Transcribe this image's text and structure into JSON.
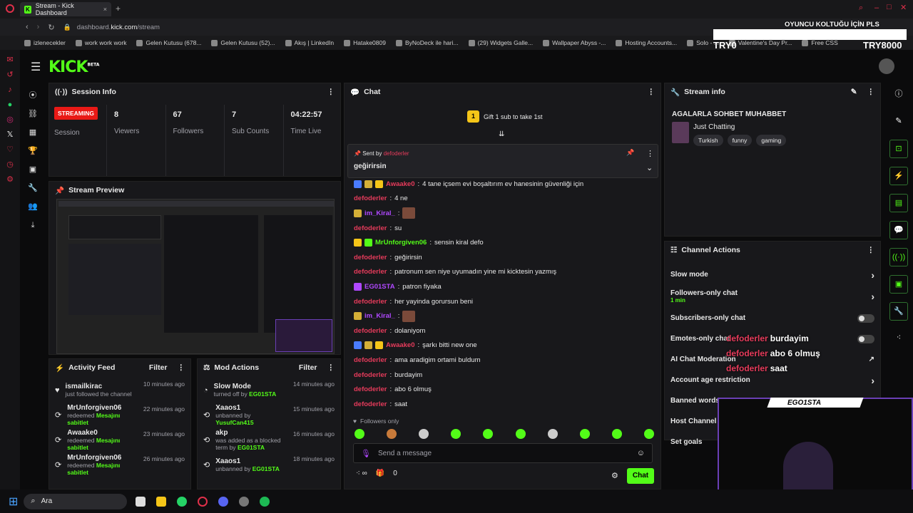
{
  "browser": {
    "tab_title": "Stream - Kick Dashboard",
    "url_prefix": "dashboard.",
    "url_domain": "kick.com",
    "url_path": "/stream",
    "bookmarks": [
      "izlenecekler",
      "work work work",
      "Gelen Kutusu (678...",
      "Gelen Kutusu (52)...",
      "Akış | LinkedIn",
      "Hatake0809",
      "ByNoDeck ile hari...",
      "(29) Widgets Galle...",
      "Wallpaper Abyss -...",
      "Hosting Accounts...",
      "Solo - ...",
      "Valentine's Day Pr...",
      "Free CSS"
    ]
  },
  "overlay_top": {
    "banner": "OYUNCU KOLTUĞU İÇİN PLS",
    "left": "TRY0",
    "right": "TRY8000"
  },
  "brand": {
    "logo": "KICK",
    "beta": "BETA"
  },
  "session": {
    "title": "Session Info",
    "status_badge": "STREAMING",
    "session_label": "Session",
    "stats": [
      {
        "value": "8",
        "label": "Viewers"
      },
      {
        "value": "67",
        "label": "Followers"
      },
      {
        "value": "7",
        "label": "Sub Counts"
      },
      {
        "value": "04:22:57",
        "label": "Time Live"
      }
    ]
  },
  "preview": {
    "title": "Stream Preview"
  },
  "activity": {
    "title": "Activity Feed",
    "filter": "Filter",
    "items": [
      {
        "user": "ismailkirac",
        "action": "just followed the channel",
        "extra": "",
        "time": "10 minutes ago"
      },
      {
        "user": "MrUnforgiven06",
        "action": "redeemed",
        "extra": "Mesajını sabitlet",
        "time": "22 minutes ago"
      },
      {
        "user": "Awaake0",
        "action": "redeemed",
        "extra": "Mesajını sabitlet",
        "time": "23 minutes ago"
      },
      {
        "user": "MrUnforgiven06",
        "action": "redeemed",
        "extra": "Mesajını sabitlet",
        "time": "26 minutes ago"
      }
    ]
  },
  "mod": {
    "title": "Mod Actions",
    "filter": "Filter",
    "items": [
      {
        "title": "Slow Mode",
        "action": "turned off by",
        "by": "EG01STA",
        "time": "14 minutes ago"
      },
      {
        "title": "Xaaos1",
        "action": "unbanned by",
        "by": "YusufCan415",
        "time": "15 minutes ago"
      },
      {
        "title": "akp",
        "action": "was added as a blocked term by",
        "by": "EG01STA",
        "time": "16 minutes ago"
      },
      {
        "title": "Xaaos1",
        "action": "unbanned by",
        "by": "EG01STA",
        "time": "18 minutes ago"
      }
    ]
  },
  "chat": {
    "title": "Chat",
    "gift_count": "1",
    "gift_text": "Gift 1 sub to take 1st",
    "pinned_prefix": "Sent by",
    "pinned_user": "defoderler",
    "pinned_msg": "geğirirsin",
    "messages": [
      {
        "user": "Awaake0",
        "color": "#e63b5b",
        "badges": [
          "#4a7cff",
          "#d4af37",
          "#f5c518"
        ],
        "text": "4 tane içsem evi boşaltırım ev hanesinin güvenliği için"
      },
      {
        "user": "defoderler",
        "color": "#e63b5b",
        "badges": [],
        "text": "4 ne"
      },
      {
        "user": "im_Kiral_",
        "color": "#b048ff",
        "badges": [
          "#d4af37"
        ],
        "text": ""
      },
      {
        "user": "defoderler",
        "color": "#e63b5b",
        "badges": [],
        "text": "su"
      },
      {
        "user": "MrUnforgiven06",
        "color": "#53fc18",
        "badges": [
          "#f5c518",
          "#53fc18"
        ],
        "text": "sensin kiral defo"
      },
      {
        "user": "defoderler",
        "color": "#e63b5b",
        "badges": [],
        "text": "geğirirsin"
      },
      {
        "user": "defoderler",
        "color": "#e63b5b",
        "badges": [],
        "text": "patronum sen niye uyumadın yine mi kicktesin yazmış"
      },
      {
        "user": "EG01STA",
        "color": "#b048ff",
        "badges": [
          "#b048ff"
        ],
        "text": "patron fiyaka"
      },
      {
        "user": "defoderler",
        "color": "#e63b5b",
        "badges": [],
        "text": "her yayinda gorursun beni"
      },
      {
        "user": "im_Kiral_",
        "color": "#b048ff",
        "badges": [
          "#d4af37"
        ],
        "text": ""
      },
      {
        "user": "defoderler",
        "color": "#e63b5b",
        "badges": [],
        "text": "dolaniyom"
      },
      {
        "user": "Awaake0",
        "color": "#e63b5b",
        "badges": [
          "#4a7cff",
          "#d4af37",
          "#f5c518"
        ],
        "text": "şarkı bitti new one"
      },
      {
        "user": "defoderler",
        "color": "#e63b5b",
        "badges": [],
        "text": "ama aradigim ortami buldum"
      },
      {
        "user": "defoderler",
        "color": "#e63b5b",
        "badges": [],
        "text": "burdayim"
      },
      {
        "user": "defoderler",
        "color": "#e63b5b",
        "badges": [],
        "text": "abo 6 olmuş"
      },
      {
        "user": "defoderler",
        "color": "#e63b5b",
        "badges": [],
        "text": "saat"
      }
    ],
    "followers_only": "Followers only",
    "input_placeholder": "Send a message",
    "points": "0",
    "send_label": "Chat"
  },
  "stream_info": {
    "title": "Stream info",
    "stream_title": "AGALARLA SOHBET MUHABBET",
    "category": "Just Chatting",
    "tags": [
      "Turkish",
      "funny",
      "gaming"
    ]
  },
  "channel_actions": {
    "title": "Channel Actions",
    "items": [
      {
        "label": "Slow mode",
        "sub": "",
        "control": "chevron"
      },
      {
        "label": "Followers-only chat",
        "sub": "1 min",
        "control": "chevron"
      },
      {
        "label": "Subscribers-only chat",
        "sub": "",
        "control": "toggle"
      },
      {
        "label": "Emotes-only chat",
        "sub": "",
        "control": "toggle"
      },
      {
        "label": "AI Chat Moderation",
        "sub": "",
        "control": "external"
      },
      {
        "label": "Account age restriction",
        "sub": "",
        "control": "chevron"
      },
      {
        "label": "Banned words",
        "sub": "",
        "control": "chevron"
      },
      {
        "label": "Host Channel",
        "sub": "",
        "control": ""
      },
      {
        "label": "Set goals",
        "sub": "",
        "control": ""
      }
    ]
  },
  "overlay_chat": [
    {
      "user": "defoderler",
      "text": "burdayim"
    },
    {
      "user": "defoderler",
      "text": "abo 6 olmuş"
    },
    {
      "user": "defoderler",
      "text": "saat"
    }
  ],
  "webcam": {
    "name": "EGO1STA"
  },
  "taskbar": {
    "search": "Ara"
  },
  "colors": {
    "accent": "#53fc18",
    "streaming": "#e91916",
    "nick_red": "#e63b5b",
    "nick_purple": "#b048ff"
  }
}
